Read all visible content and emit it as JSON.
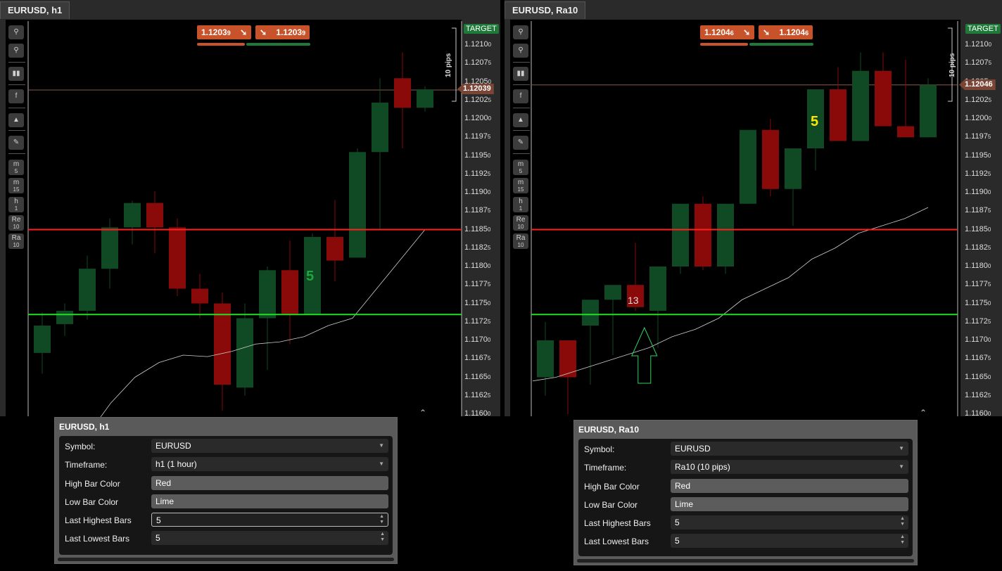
{
  "left": {
    "tab_title": "EURUSD, h1",
    "bid": "1.1203",
    "bid_sub": "9",
    "ask": "1.1203",
    "ask_sub": "9",
    "target_label": "TARGET",
    "pips_label": "10 pips",
    "current_price": "1.12039",
    "bar_count_label": "5",
    "y_ticks": [
      {
        "main": "1.1210",
        "sub": "0"
      },
      {
        "main": "1.1207",
        "sub": "5"
      },
      {
        "main": "1.1205",
        "sub": "0"
      },
      {
        "main": "1.1202",
        "sub": "5"
      },
      {
        "main": "1.1200",
        "sub": "0"
      },
      {
        "main": "1.1197",
        "sub": "5"
      },
      {
        "main": "1.1195",
        "sub": "0"
      },
      {
        "main": "1.1192",
        "sub": "5"
      },
      {
        "main": "1.1190",
        "sub": "0"
      },
      {
        "main": "1.1187",
        "sub": "5"
      },
      {
        "main": "1.1185",
        "sub": "0"
      },
      {
        "main": "1.1182",
        "sub": "5"
      },
      {
        "main": "1.1180",
        "sub": "0"
      },
      {
        "main": "1.1177",
        "sub": "5"
      },
      {
        "main": "1.1175",
        "sub": "0"
      },
      {
        "main": "1.1172",
        "sub": "5"
      },
      {
        "main": "1.1170",
        "sub": "0"
      },
      {
        "main": "1.1167",
        "sub": "5"
      },
      {
        "main": "1.1165",
        "sub": "0"
      },
      {
        "main": "1.1162",
        "sub": "5"
      },
      {
        "main": "1.1160",
        "sub": "0"
      }
    ],
    "panel": {
      "title": "EURUSD, h1",
      "rows": [
        {
          "label": "Symbol:",
          "value": "EURUSD",
          "kind": "select"
        },
        {
          "label": "Timeframe:",
          "value": "h1 (1 hour)",
          "kind": "select"
        },
        {
          "label": "High Bar Color",
          "value": "Red",
          "kind": "solid"
        },
        {
          "label": "Low Bar Color",
          "value": "Lime",
          "kind": "solid"
        },
        {
          "label": "Last Highest Bars",
          "value": "5",
          "kind": "spin-focus"
        },
        {
          "label": "Last Lowest Bars",
          "value": "5",
          "kind": "spin"
        }
      ]
    }
  },
  "right": {
    "tab_title": "EURUSD, Ra10",
    "bid": "1.1204",
    "bid_sub": "6",
    "ask": "1.1204",
    "ask_sub": "6",
    "target_label": "TARGET",
    "pips_label": "10 pips",
    "current_price": "1.12046",
    "bar_count_label": "5",
    "low_count_label": "13",
    "y_ticks": [
      {
        "main": "1.1210",
        "sub": "0"
      },
      {
        "main": "1.1207",
        "sub": "5"
      },
      {
        "main": "1.1205",
        "sub": "0"
      },
      {
        "main": "1.1202",
        "sub": "5"
      },
      {
        "main": "1.1200",
        "sub": "0"
      },
      {
        "main": "1.1197",
        "sub": "5"
      },
      {
        "main": "1.1195",
        "sub": "0"
      },
      {
        "main": "1.1192",
        "sub": "5"
      },
      {
        "main": "1.1190",
        "sub": "0"
      },
      {
        "main": "1.1187",
        "sub": "5"
      },
      {
        "main": "1.1185",
        "sub": "0"
      },
      {
        "main": "1.1182",
        "sub": "5"
      },
      {
        "main": "1.1180",
        "sub": "0"
      },
      {
        "main": "1.1177",
        "sub": "5"
      },
      {
        "main": "1.1175",
        "sub": "0"
      },
      {
        "main": "1.1172",
        "sub": "5"
      },
      {
        "main": "1.1170",
        "sub": "0"
      },
      {
        "main": "1.1167",
        "sub": "5"
      },
      {
        "main": "1.1165",
        "sub": "0"
      },
      {
        "main": "1.1162",
        "sub": "5"
      },
      {
        "main": "1.1160",
        "sub": "0"
      }
    ],
    "panel": {
      "title": "EURUSD, Ra10",
      "rows": [
        {
          "label": "Symbol:",
          "value": "EURUSD",
          "kind": "select"
        },
        {
          "label": "Timeframe:",
          "value": "Ra10 (10 pips)",
          "kind": "select"
        },
        {
          "label": "High Bar Color",
          "value": "Red",
          "kind": "solid"
        },
        {
          "label": "Low Bar Color",
          "value": "Lime",
          "kind": "solid"
        },
        {
          "label": "Last Highest Bars",
          "value": "5",
          "kind": "spin"
        },
        {
          "label": "Last Lowest Bars",
          "value": "5",
          "kind": "spin"
        }
      ]
    }
  },
  "toolbar_items": [
    {
      "icon": "zoom-in-icon",
      "glyph": "⚲",
      "sub": ""
    },
    {
      "icon": "zoom-out-icon",
      "glyph": "⚲",
      "sub": ""
    },
    {
      "icon": "chart-type-icon",
      "glyph": "▮▮",
      "sub": ""
    },
    {
      "icon": "social-icon",
      "glyph": "f",
      "sub": ""
    },
    {
      "icon": "shapes-icon",
      "glyph": "▲",
      "sub": ""
    },
    {
      "icon": "settings-icon",
      "glyph": "✎",
      "sub": ""
    },
    {
      "icon": "timeframe-m5-icon",
      "glyph": "m",
      "sub": "5"
    },
    {
      "icon": "timeframe-m15-icon",
      "glyph": "m",
      "sub": "15"
    },
    {
      "icon": "timeframe-h1-icon",
      "glyph": "h",
      "sub": "1"
    },
    {
      "icon": "timeframe-re10-icon",
      "glyph": "Re",
      "sub": "10"
    },
    {
      "icon": "timeframe-ra10-icon",
      "glyph": "Ra",
      "sub": "10"
    }
  ],
  "colors": {
    "bull": "#0f4a25",
    "bear": "#8a0a0a",
    "high_line": "#ff2020",
    "low_line": "#20e020",
    "ma": "#cfcfcf"
  },
  "chart_data": [
    {
      "type": "candlestick",
      "title": "EURUSD, h1",
      "ylim": [
        1.116,
        1.121
      ],
      "high_level": 1.1185,
      "low_level": 1.11735,
      "last_price": 1.12039,
      "candles": [
        {
          "o": 1.11683,
          "h": 1.11738,
          "l": 1.11655,
          "c": 1.1172
        },
        {
          "o": 1.11722,
          "h": 1.1175,
          "l": 1.11706,
          "c": 1.1174
        },
        {
          "o": 1.1174,
          "h": 1.11815,
          "l": 1.11728,
          "c": 1.11797
        },
        {
          "o": 1.11797,
          "h": 1.11865,
          "l": 1.1177,
          "c": 1.11853
        },
        {
          "o": 1.11853,
          "h": 1.11889,
          "l": 1.1183,
          "c": 1.11886
        },
        {
          "o": 1.11886,
          "h": 1.11902,
          "l": 1.11818,
          "c": 1.11853
        },
        {
          "o": 1.11853,
          "h": 1.11865,
          "l": 1.1176,
          "c": 1.1177
        },
        {
          "o": 1.1177,
          "h": 1.1179,
          "l": 1.1173,
          "c": 1.1175
        },
        {
          "o": 1.1175,
          "h": 1.11765,
          "l": 1.11605,
          "c": 1.1164
        },
        {
          "o": 1.11636,
          "h": 1.1175,
          "l": 1.11625,
          "c": 1.1173
        },
        {
          "o": 1.1173,
          "h": 1.118,
          "l": 1.1166,
          "c": 1.11795
        },
        {
          "o": 1.11795,
          "h": 1.11835,
          "l": 1.11695,
          "c": 1.11735
        },
        {
          "o": 1.11735,
          "h": 1.11845,
          "l": 1.11735,
          "c": 1.1184
        },
        {
          "o": 1.1184,
          "h": 1.1189,
          "l": 1.1178,
          "c": 1.11808
        },
        {
          "o": 1.11812,
          "h": 1.1196,
          "l": 1.1185,
          "c": 1.11955
        },
        {
          "o": 1.11955,
          "h": 1.12055,
          "l": 1.1185,
          "c": 1.12022
        },
        {
          "o": 1.12055,
          "h": 1.1209,
          "l": 1.1196,
          "c": 1.12015
        },
        {
          "o": 1.12015,
          "h": 1.12044,
          "l": 1.1201,
          "c": 1.1204
        }
      ],
      "ma": [
        1.1157,
        1.11615,
        1.1165,
        1.1167,
        1.1168,
        1.11678,
        1.11685,
        1.11695,
        1.11698,
        1.11705,
        1.1172,
        1.1173,
        1.1177,
        1.1181,
        1.1185
      ]
    },
    {
      "type": "candlestick",
      "title": "EURUSD, Ra10",
      "ylim": [
        1.116,
        1.121
      ],
      "high_level": 1.1185,
      "low_level": 1.11735,
      "last_price": 1.12046,
      "candles": [
        {
          "o": 1.1165,
          "h": 1.11725,
          "l": 1.11625,
          "c": 1.117
        },
        {
          "o": 1.117,
          "h": 1.117,
          "l": 1.116,
          "c": 1.1165
        },
        {
          "o": 1.1172,
          "h": 1.1175,
          "l": 1.1164,
          "c": 1.11755
        },
        {
          "o": 1.11755,
          "h": 1.1177,
          "l": 1.1168,
          "c": 1.11775
        },
        {
          "o": 1.11775,
          "h": 1.11832,
          "l": 1.1174,
          "c": 1.11745
        },
        {
          "o": 1.1174,
          "h": 1.11795,
          "l": 1.1169,
          "c": 1.118
        },
        {
          "o": 1.118,
          "h": 1.11885,
          "l": 1.1179,
          "c": 1.11885
        },
        {
          "o": 1.11885,
          "h": 1.11895,
          "l": 1.11795,
          "c": 1.118
        },
        {
          "o": 1.118,
          "h": 1.11885,
          "l": 1.1179,
          "c": 1.11885
        },
        {
          "o": 1.11885,
          "h": 1.11985,
          "l": 1.11885,
          "c": 1.11985
        },
        {
          "o": 1.11985,
          "h": 1.12,
          "l": 1.11895,
          "c": 1.11905
        },
        {
          "o": 1.11905,
          "h": 1.11905,
          "l": 1.11855,
          "c": 1.1196
        },
        {
          "o": 1.1196,
          "h": 1.1204,
          "l": 1.1193,
          "c": 1.1204
        },
        {
          "o": 1.1204,
          "h": 1.1207,
          "l": 1.1197,
          "c": 1.1197
        },
        {
          "o": 1.1197,
          "h": 1.1209,
          "l": 1.1197,
          "c": 1.12065
        },
        {
          "o": 1.12065,
          "h": 1.1209,
          "l": 1.1199,
          "c": 1.1199
        },
        {
          "o": 1.1199,
          "h": 1.1208,
          "l": 1.1198,
          "c": 1.11975
        },
        {
          "o": 1.11975,
          "h": 1.12055,
          "l": 1.11975,
          "c": 1.12046
        }
      ],
      "ma": [
        1.11645,
        1.1165,
        1.1166,
        1.1167,
        1.1168,
        1.1169,
        1.11705,
        1.11715,
        1.1173,
        1.11755,
        1.1177,
        1.11785,
        1.1181,
        1.11825,
        1.11845,
        1.11855,
        1.11865,
        1.1188
      ]
    }
  ]
}
